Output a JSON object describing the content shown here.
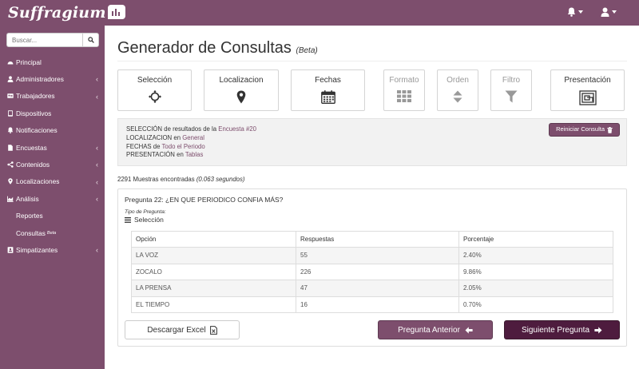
{
  "app": {
    "brand": "Suffragium"
  },
  "sidebar": {
    "search_placeholder": "Buscar...",
    "items": [
      {
        "label": "Principal",
        "icon": "dashboard-icon"
      },
      {
        "label": "Administradores",
        "icon": "user-icon",
        "has_children": true
      },
      {
        "label": "Trabajadores",
        "icon": "id-card-icon",
        "has_children": true
      },
      {
        "label": "Dispositivos",
        "icon": "tablet-icon"
      },
      {
        "label": "Notificaciones",
        "icon": "bell-icon"
      },
      {
        "label": "Encuestas",
        "icon": "document-icon",
        "has_children": true
      },
      {
        "label": "Contenidos",
        "icon": "share-icon",
        "has_children": true
      },
      {
        "label": "Localizaciones",
        "icon": "map-marker-icon",
        "has_children": true
      },
      {
        "label": "Análisis",
        "icon": "chart-icon",
        "has_children": true
      }
    ],
    "subitems": [
      {
        "label": "Reportes"
      },
      {
        "label": "Consultas",
        "badge": "Beta"
      }
    ],
    "last_item": {
      "label": "Simpatizantes",
      "icon": "address-book-icon",
      "has_children": true
    }
  },
  "page": {
    "title": "Generador de Consultas",
    "title_tag": "(Beta)"
  },
  "steps": [
    {
      "label": "Selección",
      "icon": "crosshair-icon",
      "active": true
    },
    {
      "label": "Localizacion",
      "icon": "map-marker-icon",
      "active": true
    },
    {
      "label": "Fechas",
      "icon": "calendar-icon",
      "active": true
    },
    {
      "label": "Formato",
      "icon": "grid-icon",
      "active": false
    },
    {
      "label": "Orden",
      "icon": "sort-icon",
      "active": false
    },
    {
      "label": "Filtro",
      "icon": "filter-icon",
      "active": false
    },
    {
      "label": "Presentación",
      "icon": "presentation-icon",
      "active": true
    }
  ],
  "summary": {
    "line1_prefix": "SELECCIÓN",
    "line1_mid": " de resultados de la ",
    "line1_value": "Encuesta #20",
    "line2_prefix": "LOCALIZACION",
    "line2_mid": " en ",
    "line2_value": "General",
    "line3_prefix": "FECHAS",
    "line3_mid": " de ",
    "line3_value": "Todo el Periodo",
    "line4_prefix": "PRESENTACIÓN",
    "line4_mid": " en ",
    "line4_value": "Tablas",
    "reset_label": "Reiniciar Consulta"
  },
  "results": {
    "count_text": "2291 Muestras encontradas",
    "time_text": "(0.063 segundos)"
  },
  "question": {
    "title": "Pregunta 22: ¿EN QUE PERIODICO CONFIA MÁS?",
    "type_label": "Tipo de Pregunta:",
    "type_value": "Selección",
    "columns": [
      "Opción",
      "Respuestas",
      "Porcentaje"
    ],
    "rows": [
      {
        "option": "LA VOZ",
        "responses": "55",
        "percent": "2.40%"
      },
      {
        "option": "ZOCALO",
        "responses": "226",
        "percent": "9.86%"
      },
      {
        "option": "LA PRENSA",
        "responses": "47",
        "percent": "2.05%"
      },
      {
        "option": "EL TIEMPO",
        "responses": "16",
        "percent": "0.70%"
      }
    ]
  },
  "buttons": {
    "excel": "Descargar Excel",
    "prev": "Pregunta Anterior",
    "next": "Siguiente Pregunta"
  },
  "colors": {
    "brand": "#7d4e6d",
    "dark": "#4e1c3e",
    "accent_text": "#7d4e6d"
  }
}
